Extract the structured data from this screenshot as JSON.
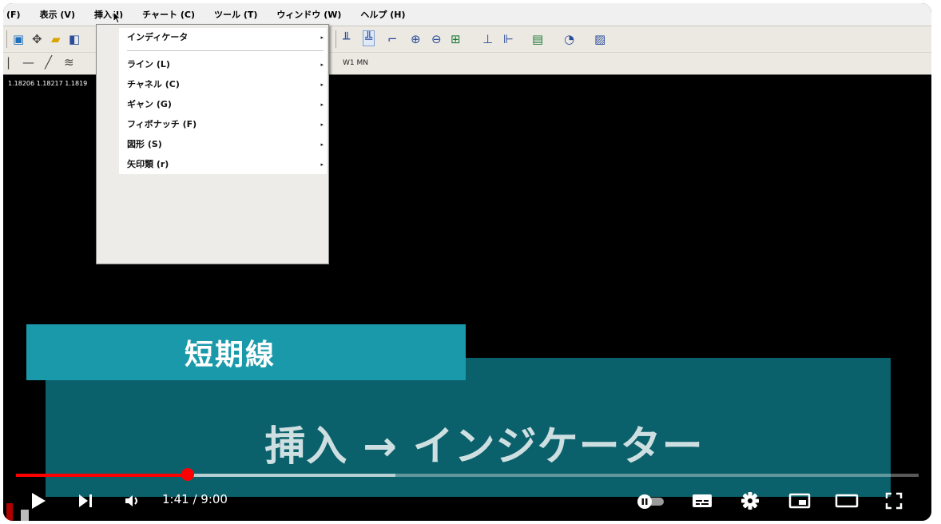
{
  "menu": [
    "(F)",
    "表示 (V)",
    "挿入(I)",
    "チャート (C)",
    "ツール (T)",
    "ウィンドウ (W)",
    "ヘルプ (H)"
  ],
  "price_line": "1.18206 1.18217 1.1819",
  "timeframes": "W1  MN",
  "dropdown": {
    "items": [
      {
        "label": "インディケータ",
        "arrow": "▸"
      },
      {
        "label": "ライン (L)",
        "arrow": "▸"
      },
      {
        "label": "チャネル (C)",
        "arrow": "▸"
      },
      {
        "label": "ギャン (G)",
        "arrow": "▸"
      },
      {
        "label": "フィボナッチ (F)",
        "arrow": "▸"
      },
      {
        "label": "図形 (S)",
        "arrow": "▸"
      },
      {
        "label": "矢印類 (r)",
        "arrow": "▸"
      }
    ]
  },
  "caption_short": "短期線",
  "caption_main": "挿入 → インジケーター",
  "player": {
    "time": "1:41 / 9:00",
    "progress_fraction": 0.19,
    "buffered_fraction": 0.42,
    "accent": "#ff0000",
    "icons": [
      "play-icon",
      "next-icon",
      "volume-icon",
      "autoplay-toggle-icon",
      "subtitles-icon",
      "settings-icon",
      "miniplayer-icon",
      "theater-icon",
      "fullscreen-icon"
    ]
  }
}
